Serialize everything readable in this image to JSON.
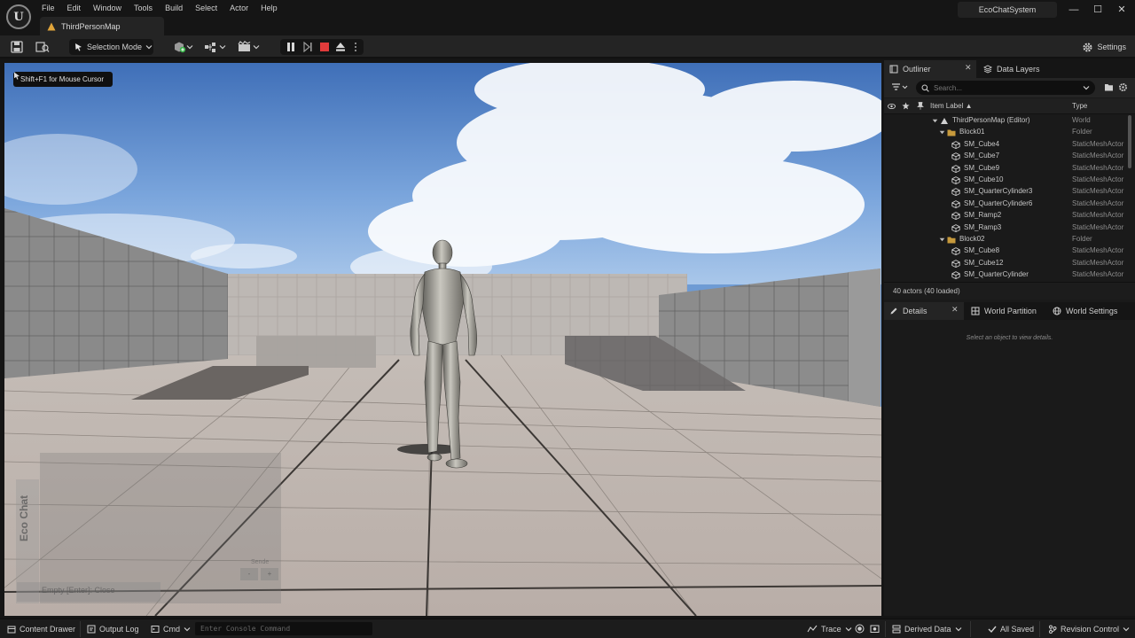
{
  "app": {
    "logo_glyph": "U",
    "map_tab_title": "ThirdPersonMap",
    "project_name": "EcoChatSystem",
    "window_controls": {
      "minimize": "—",
      "maximize": "☐",
      "close": "✕"
    }
  },
  "menu": [
    "File",
    "Edit",
    "Window",
    "Tools",
    "Build",
    "Select",
    "Actor",
    "Help"
  ],
  "toolbar": {
    "selection_mode": "Selection Mode",
    "settings": "Settings"
  },
  "viewport": {
    "cursor_hint": "Shift+F1 for Mouse Cursor",
    "eco_panel_label": "Eco Chat",
    "eco_input_placeholder": "Empty [Enter]: Close",
    "eco_send_label": "Sende",
    "eco_buttons": [
      "-",
      "+"
    ]
  },
  "outliner": {
    "tab_label": "Outliner",
    "data_layers_tab": "Data Layers",
    "search_placeholder": "Search...",
    "col_label": "Item Label ▲",
    "col_type": "Type",
    "rows": [
      {
        "label": "ThirdPersonMap (Editor)",
        "type": "World",
        "kind": "world",
        "depth": 0,
        "expanded": true
      },
      {
        "label": "Block01",
        "type": "Folder",
        "kind": "folder",
        "depth": 1,
        "expanded": true
      },
      {
        "label": "SM_Cube4",
        "type": "StaticMeshActor",
        "kind": "mesh",
        "depth": 2
      },
      {
        "label": "SM_Cube7",
        "type": "StaticMeshActor",
        "kind": "mesh",
        "depth": 2
      },
      {
        "label": "SM_Cube9",
        "type": "StaticMeshActor",
        "kind": "mesh",
        "depth": 2
      },
      {
        "label": "SM_Cube10",
        "type": "StaticMeshActor",
        "kind": "mesh",
        "depth": 2
      },
      {
        "label": "SM_QuarterCylinder3",
        "type": "StaticMeshActor",
        "kind": "mesh",
        "depth": 2
      },
      {
        "label": "SM_QuarterCylinder6",
        "type": "StaticMeshActor",
        "kind": "mesh",
        "depth": 2
      },
      {
        "label": "SM_Ramp2",
        "type": "StaticMeshActor",
        "kind": "mesh",
        "depth": 2
      },
      {
        "label": "SM_Ramp3",
        "type": "StaticMeshActor",
        "kind": "mesh",
        "depth": 2
      },
      {
        "label": "Block02",
        "type": "Folder",
        "kind": "folder",
        "depth": 1,
        "expanded": true
      },
      {
        "label": "SM_Cube8",
        "type": "StaticMeshActor",
        "kind": "mesh",
        "depth": 2
      },
      {
        "label": "SM_Cube12",
        "type": "StaticMeshActor",
        "kind": "mesh",
        "depth": 2
      },
      {
        "label": "SM_QuarterCylinder",
        "type": "StaticMeshActor",
        "kind": "mesh",
        "depth": 2
      }
    ],
    "actor_count": "40 actors (40 loaded)"
  },
  "details": {
    "tab_label": "Details",
    "world_partition_tab": "World Partition",
    "world_settings_tab": "World Settings",
    "empty_message": "Select an object to view details."
  },
  "statusbar": {
    "content_drawer": "Content Drawer",
    "output_log": "Output Log",
    "cmd": "Cmd",
    "console_placeholder": "Enter Console Command",
    "trace": "Trace",
    "derived_data": "Derived Data",
    "all_saved": "All Saved",
    "revision_control": "Revision Control"
  },
  "colors": {
    "accent_folder": "#c79a3c",
    "stop_red": "#e03b3b",
    "panel_bg": "#1a1a1a"
  }
}
